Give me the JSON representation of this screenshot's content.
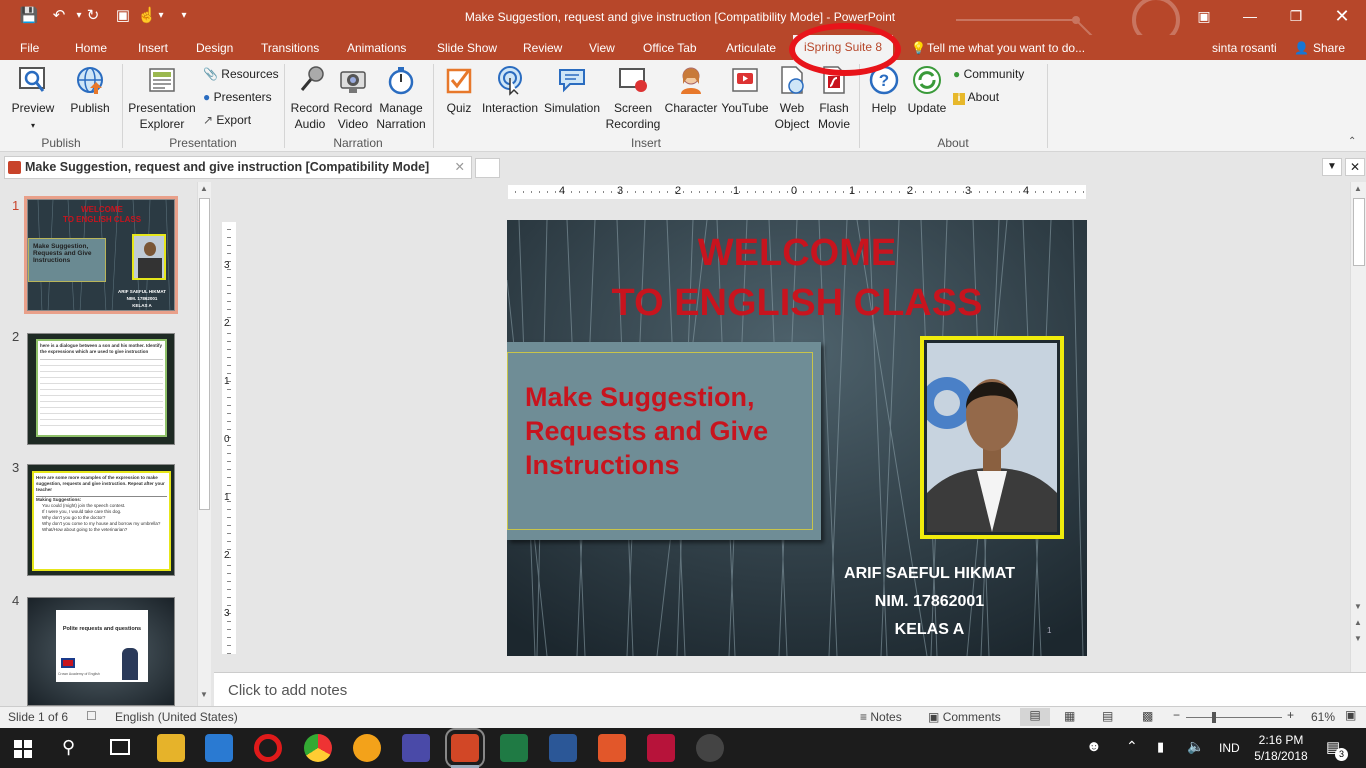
{
  "window": {
    "title": "Make Suggestion, request and give instruction [Compatibility Mode] - PowerPoint"
  },
  "tabs": {
    "file": "File",
    "home": "Home",
    "insert": "Insert",
    "design": "Design",
    "transitions": "Transitions",
    "animations": "Animations",
    "slideshow": "Slide Show",
    "review": "Review",
    "view": "View",
    "officetab": "Office Tab",
    "articulate": "Articulate",
    "ispring": "iSpring Suite 8",
    "tellme": "Tell me what you want to do...",
    "user": "sinta rosanti",
    "share": "Share"
  },
  "ribbon": {
    "preview": "Preview",
    "publish": "Publish",
    "pres_explorer_1": "Presentation",
    "pres_explorer_2": "Explorer",
    "resources": "Resources",
    "presenters": "Presenters",
    "export": "Export",
    "record_audio_1": "Record",
    "record_audio_2": "Audio",
    "record_video_1": "Record",
    "record_video_2": "Video",
    "manage_narr_1": "Manage",
    "manage_narr_2": "Narration",
    "quiz": "Quiz",
    "interaction": "Interaction",
    "simulation": "Simulation",
    "screen_rec_1": "Screen",
    "screen_rec_2": "Recording",
    "character": "Character",
    "youtube": "YouTube",
    "web_object_1": "Web",
    "web_object_2": "Object",
    "flash_movie_1": "Flash",
    "flash_movie_2": "Movie",
    "help": "Help",
    "update": "Update",
    "community": "Community",
    "about": "About",
    "groups": {
      "publish": "Publish",
      "presentation": "Presentation",
      "narration": "Narration",
      "insert": "Insert",
      "about": "About"
    }
  },
  "doc_tab": {
    "title": "Make Suggestion, request and give instruction [Compatibility Mode]"
  },
  "thumbnails": [
    {
      "num": "1"
    },
    {
      "num": "2",
      "text": "here is a dialogue between a son and his mother. Identify the expressions which are used to give instruction"
    },
    {
      "num": "3",
      "text": "Here are some more examples of the expression to make suggestion, requests and give instruction. Repeat after your teacher",
      "sub": "Making Suggestions:",
      "items": [
        "You could (might) join the speech contest.",
        "If I were you, I would take care this dog.",
        "Why don't you go to the doctor?",
        "Why don't you come to my house and borrow my umbrella?",
        "What/How about going to the veterinarian?"
      ]
    },
    {
      "num": "4",
      "text": "Polite requests and questions",
      "small": "Crown Academy of English"
    }
  ],
  "ruler": {
    "h": [
      "4",
      "3",
      "2",
      "1",
      "0",
      "1",
      "2",
      "3",
      "4"
    ],
    "v": [
      "3",
      "2",
      "1",
      "0",
      "1",
      "2",
      "3"
    ]
  },
  "slide": {
    "title1": "WELCOME",
    "title2": "TO ENGLISH CLASS",
    "subtitle1": "Make Suggestion,",
    "subtitle2": "Requests and Give",
    "subtitle3": "Instructions",
    "name": "ARIF SAEFUL  HIKMAT",
    "nim": "NIM. 17862001",
    "kelas": "KELAS A",
    "page": "1",
    "thumb_title1": "WELCOME",
    "thumb_title2": "TO ENGLISH CLASS",
    "thumb_sub": "Make Suggestion, Requests and Give Instructions",
    "thumb_name": "ARIF SAEFUL HIKMAT",
    "thumb_nim": "NIM. 17862001",
    "thumb_kelas": "KELAS A"
  },
  "notes": {
    "placeholder": "Click to add notes"
  },
  "status": {
    "slide": "Slide 1 of 6",
    "language": "English (United States)",
    "notes": "Notes",
    "comments": "Comments",
    "zoom": "61%"
  },
  "taskbar": {
    "lang": "IND",
    "time": "2:16 PM",
    "date": "5/18/2018",
    "notif": "3"
  },
  "colors": {
    "accent": "#b7472a",
    "slide_red": "#c8141e",
    "highlight": "#e8141a"
  }
}
